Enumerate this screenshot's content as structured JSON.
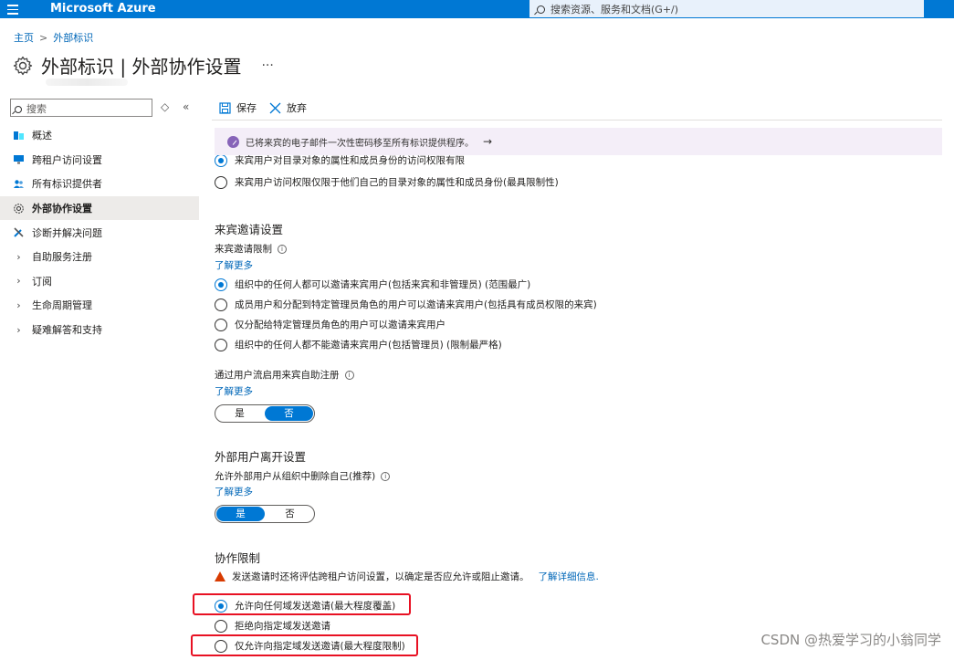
{
  "topbar": {
    "brand": "Microsoft Azure",
    "search_placeholder": "搜索资源、服务和文档(G+/)"
  },
  "breadcrumb": {
    "home": "主页",
    "current": "外部标识"
  },
  "page": {
    "title": "外部标识 | 外部协作设置",
    "more": "···"
  },
  "nav": {
    "search_placeholder": "搜索",
    "items": [
      {
        "label": "概述"
      },
      {
        "label": "跨租户访问设置"
      },
      {
        "label": "所有标识提供者"
      },
      {
        "label": "外部协作设置"
      },
      {
        "label": "诊断并解决问题"
      },
      {
        "label": "自助服务注册"
      },
      {
        "label": "订阅"
      },
      {
        "label": "生命周期管理"
      },
      {
        "label": "疑难解答和支持"
      }
    ]
  },
  "toolbar": {
    "save": "保存",
    "discard": "放弃"
  },
  "banner": {
    "text": "已将来宾的电子邮件一次性密码移至所有标识提供程序。",
    "arrow": "→"
  },
  "guest_access": {
    "opt1": "来宾用户对目录对象的属性和成员身份的访问权限有限",
    "opt2": "来宾用户访问权限仅限于他们自己的目录对象的属性和成员身份(最具限制性)"
  },
  "invite": {
    "section": "来宾邀请设置",
    "label": "来宾邀请限制",
    "learn_more": "了解更多",
    "options": [
      "组织中的任何人都可以邀请来宾用户(包括来宾和非管理员) (范围最广)",
      "成员用户和分配到特定管理员角色的用户可以邀请来宾用户(包括具有成员权限的来宾)",
      "仅分配给特定管理员角色的用户可以邀请来宾用户",
      "组织中的任何人都不能邀请来宾用户(包括管理员) (限制最严格)"
    ],
    "self_service_label": "通过用户流启用来宾自助注册",
    "learn_more2": "了解更多",
    "yes": "是",
    "no": "否"
  },
  "leave": {
    "section": "外部用户离开设置",
    "label": "允许外部用户从组织中删除自己(推荐)",
    "learn_more": "了解更多",
    "yes": "是",
    "no": "否"
  },
  "collab": {
    "section": "协作限制",
    "warning": "发送邀请时还将评估跨租户访问设置，以确定是否应允许或阻止邀请。",
    "warning_link": "了解详细信息.",
    "options": [
      "允许向任何域发送邀请(最大程度覆盖)",
      "拒绝向指定域发送邀请",
      "仅允许向指定域发送邀请(最大程度限制)"
    ]
  },
  "watermark": "CSDN @热爱学习的小翁同学"
}
